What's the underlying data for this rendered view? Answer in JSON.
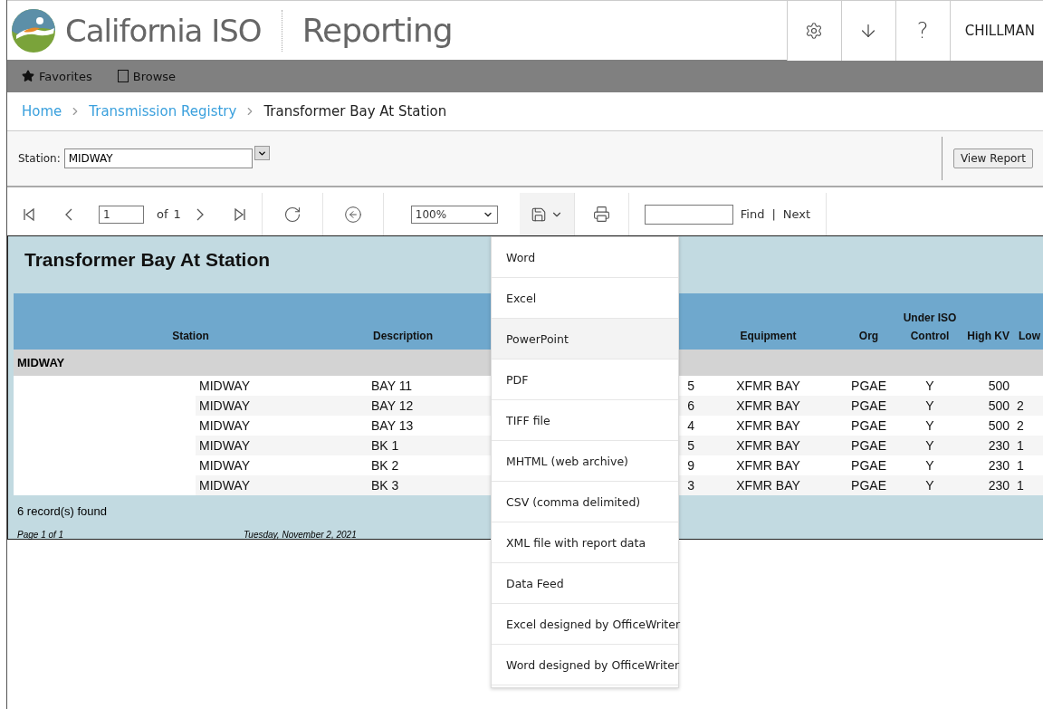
{
  "header": {
    "logo_text": "California ISO",
    "app_title": "Reporting",
    "help": "?",
    "user": "CHILLMAN"
  },
  "nav": [
    {
      "kind": "favorites",
      "label": "Favorites"
    },
    {
      "kind": "browse",
      "label": "Browse"
    }
  ],
  "breadcrumb": [
    {
      "label": "Home",
      "link": true
    },
    {
      "label": "Transmission Registry",
      "link": true
    },
    {
      "label": "Transformer Bay At Station",
      "link": false
    }
  ],
  "parameters": {
    "label": "Station:",
    "value": "MIDWAY",
    "submit": "View Report"
  },
  "toolbar": {
    "page": "1",
    "of": "of",
    "total": "1",
    "zoom": "100%",
    "find": "Find",
    "separator": "|",
    "next": "Next"
  },
  "export_menu": {
    "items": [
      {
        "label": "Word",
        "highlighted": false
      },
      {
        "label": "Excel",
        "highlighted": false
      },
      {
        "label": "PowerPoint",
        "highlighted": true
      },
      {
        "label": "PDF",
        "highlighted": false
      },
      {
        "label": "TIFF file",
        "highlighted": false
      },
      {
        "label": "MHTML (web archive)",
        "highlighted": false
      },
      {
        "label": "CSV (comma delimited)",
        "highlighted": false
      },
      {
        "label": "XML file with report data",
        "highlighted": false
      },
      {
        "label": "Data Feed",
        "highlighted": false
      },
      {
        "label": "Excel designed by OfficeWriter",
        "highlighted": false
      },
      {
        "label": "Word designed by OfficeWriter",
        "highlighted": false
      }
    ]
  },
  "report": {
    "title": "Transformer Bay At Station",
    "columns": [
      {
        "label": "Station"
      },
      {
        "label": "Description"
      },
      {},
      {
        "label": "Equipment"
      },
      {
        "label": "Org"
      },
      {
        "label": "Under ISO Control"
      },
      {
        "label": "High KV"
      },
      {
        "label": "Low"
      }
    ],
    "group": "MIDWAY",
    "rows": [
      [
        "MIDWAY",
        "BAY 11",
        "5",
        "XFMR BAY",
        "PGAE",
        "Y",
        "500",
        ""
      ],
      [
        "MIDWAY",
        "BAY 12",
        "6",
        "XFMR BAY",
        "PGAE",
        "Y",
        "500",
        "2"
      ],
      [
        "MIDWAY",
        "BAY 13",
        "4",
        "XFMR BAY",
        "PGAE",
        "Y",
        "500",
        "2"
      ],
      [
        "MIDWAY",
        "BK 1",
        "5",
        "XFMR BAY",
        "PGAE",
        "Y",
        "230",
        "1"
      ],
      [
        "MIDWAY",
        "BK 2",
        "9",
        "XFMR BAY",
        "PGAE",
        "Y",
        "230",
        "1"
      ],
      [
        "MIDWAY",
        "BK 3",
        "3",
        "XFMR BAY",
        "PGAE",
        "Y",
        "230",
        "1"
      ]
    ],
    "records": "6 record(s) found",
    "page": "Page 1 of 1",
    "date": "Tuesday, November 2, 2021"
  }
}
